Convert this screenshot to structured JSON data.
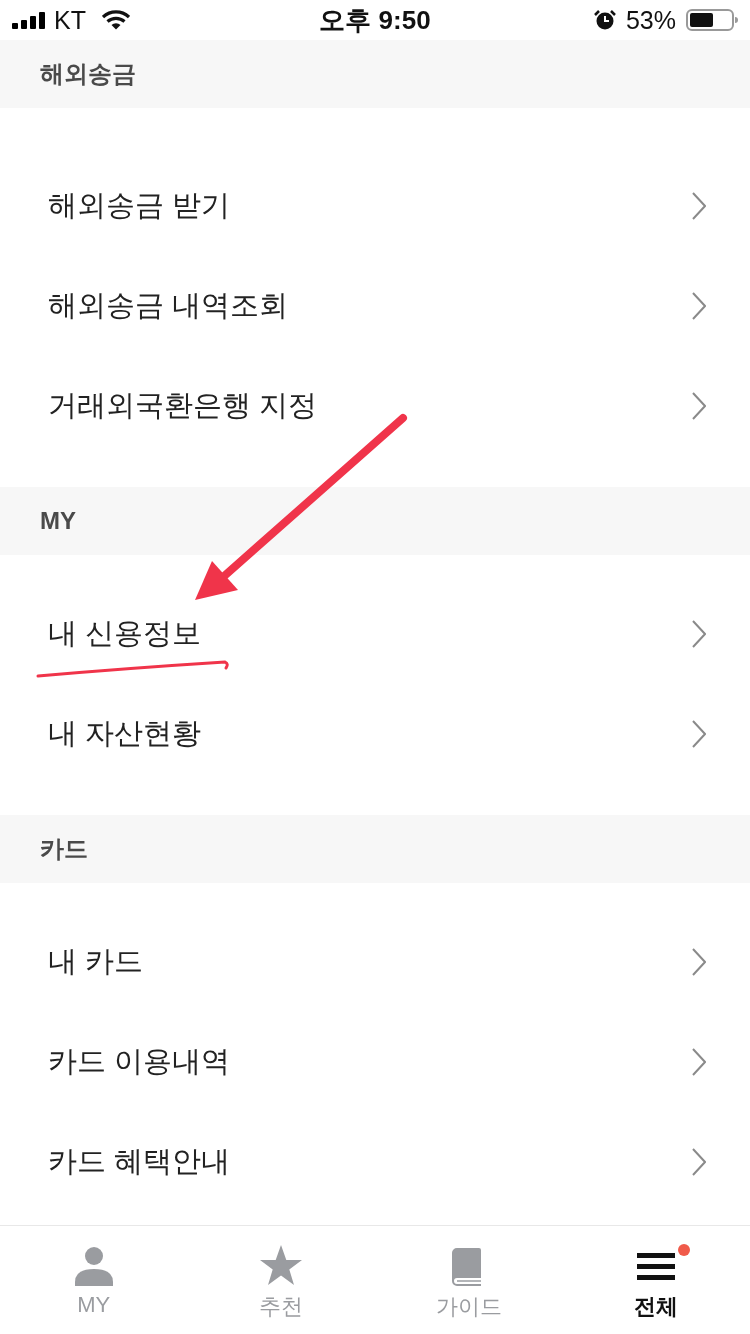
{
  "status_bar": {
    "carrier": "KT",
    "time": "오후 9:50",
    "battery": "53%"
  },
  "sections": [
    {
      "title": "해외송금",
      "items": [
        {
          "label": "해외송금 받기",
          "highlighted": false
        },
        {
          "label": "해외송금 내역조회",
          "highlighted": false
        },
        {
          "label": "거래외국환은행 지정",
          "highlighted": false
        }
      ]
    },
    {
      "title": "MY",
      "items": [
        {
          "label": "내 신용정보",
          "highlighted": true
        },
        {
          "label": "내 자산현황",
          "highlighted": false
        }
      ]
    },
    {
      "title": "카드",
      "items": [
        {
          "label": "내 카드",
          "highlighted": false
        },
        {
          "label": "카드 이용내역",
          "highlighted": false
        },
        {
          "label": "카드 혜택안내",
          "highlighted": false
        }
      ]
    }
  ],
  "tabs": [
    {
      "label": "MY",
      "kind": "person",
      "selected": false,
      "badge": false
    },
    {
      "label": "추천",
      "kind": "star",
      "selected": false,
      "badge": false
    },
    {
      "label": "가이드",
      "kind": "book",
      "selected": false,
      "badge": false
    },
    {
      "label": "전체",
      "kind": "menu",
      "selected": true,
      "badge": true
    }
  ]
}
